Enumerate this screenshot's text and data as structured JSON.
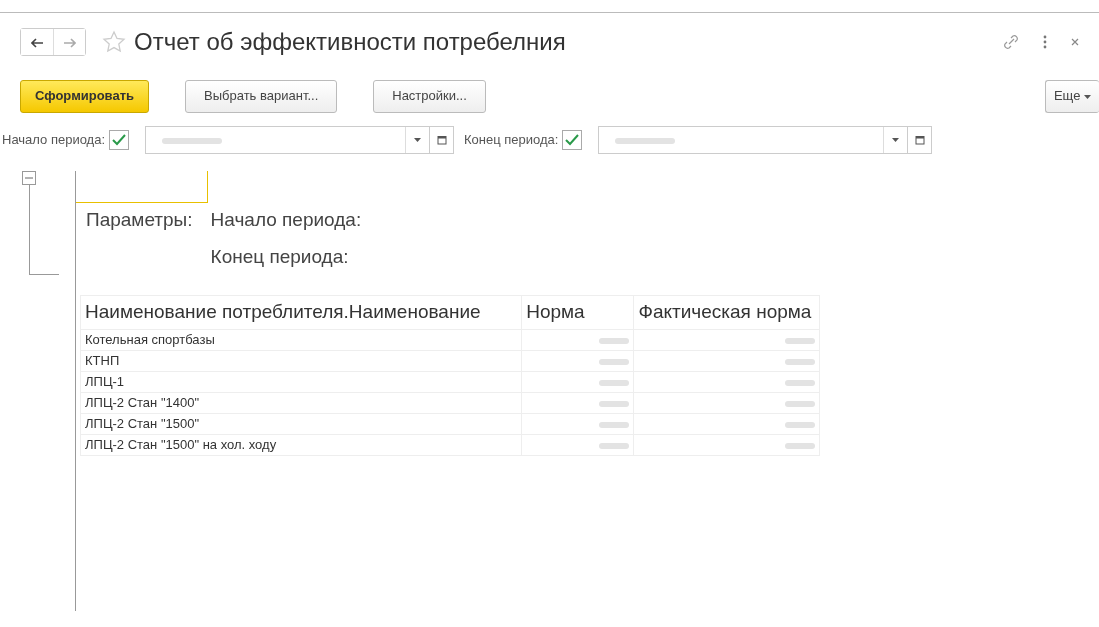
{
  "window": {
    "title": "Отчет об эффективности потребелния"
  },
  "toolbar": {
    "buttons": [
      {
        "label": "Сформировать",
        "kind": "primary"
      },
      {
        "label": "Выбрать вариант...",
        "kind": "default"
      },
      {
        "label": "Настройки...",
        "kind": "default"
      }
    ],
    "more": "Еще"
  },
  "period": [
    {
      "label": "Начало периода:",
      "checked": true
    },
    {
      "label": "Конец периода:",
      "checked": true
    }
  ],
  "report": {
    "expanded": true,
    "params_label": "Параметры:",
    "params": [
      "Начало периода:",
      "Конец периода:"
    ],
    "columns": [
      "Наименование потреблителя.Наименование",
      "Норма",
      "Фактическая норма"
    ],
    "rows": [
      "Котельная спортбазы",
      "КТНП",
      "ЛПЦ-1",
      "ЛПЦ-2 Стан \"1400\"",
      "ЛПЦ-2 Стан \"1500\"",
      "ЛПЦ-2 Стан \"1500\" на хол. ходу"
    ]
  }
}
